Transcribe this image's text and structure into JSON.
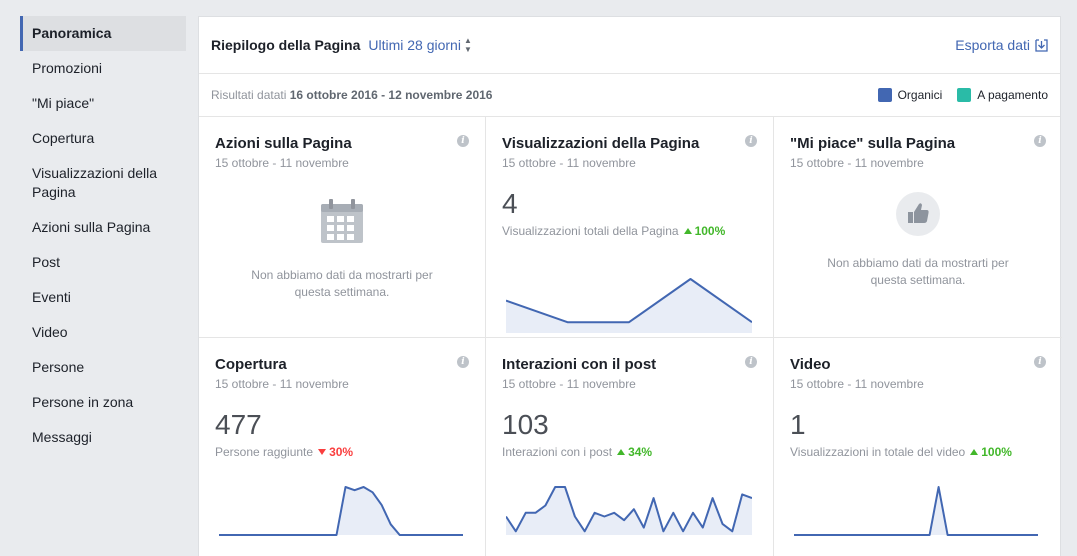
{
  "sidebar": {
    "items": [
      {
        "label": "Panoramica",
        "active": true
      },
      {
        "label": "Promozioni"
      },
      {
        "label": "\"Mi piace\""
      },
      {
        "label": "Copertura"
      },
      {
        "label": "Visualizzazioni della Pagina"
      },
      {
        "label": "Azioni sulla Pagina"
      },
      {
        "label": "Post"
      },
      {
        "label": "Eventi"
      },
      {
        "label": "Video"
      },
      {
        "label": "Persone"
      },
      {
        "label": "Persone in zona"
      },
      {
        "label": "Messaggi"
      }
    ]
  },
  "header": {
    "title": "Riepilogo della Pagina",
    "period": "Ultimi 28 giorni",
    "export_label": "Esporta dati"
  },
  "subheader": {
    "prefix": "Risultati datati",
    "range": "16 ottobre 2016 - 12 novembre 2016"
  },
  "legend": {
    "organic": {
      "label": "Organici",
      "color": "#4267b2"
    },
    "paid": {
      "label": "A pagamento",
      "color": "#2abba7"
    }
  },
  "cards": {
    "azioni": {
      "title": "Azioni sulla Pagina",
      "date": "15 ottobre - 11 novembre",
      "icon": "calendar-icon",
      "empty_text": "Non abbiamo dati da mostrarti per questa settimana."
    },
    "visualizzazioni": {
      "title": "Visualizzazioni della Pagina",
      "date": "15 ottobre - 11 novembre",
      "value": "4",
      "metric": "Visualizzazioni totali della Pagina",
      "delta": "100%",
      "trend": "up",
      "chart_data": {
        "type": "area",
        "values": [
          3,
          1,
          1,
          5,
          1
        ]
      }
    },
    "mipiace": {
      "title": "\"Mi piace\" sulla Pagina",
      "date": "15 ottobre - 11 novembre",
      "icon": "thumbs-up-icon",
      "empty_text": "Non abbiamo dati da mostrarti per questa settimana."
    },
    "copertura": {
      "title": "Copertura",
      "date": "15 ottobre - 11 novembre",
      "value": "477",
      "metric": "Persone raggiunte",
      "delta": "30%",
      "trend": "down",
      "chart_data": {
        "type": "area",
        "values": [
          0,
          0,
          0,
          0,
          0,
          0,
          0,
          0,
          0,
          0,
          0,
          0,
          0,
          0,
          45,
          42,
          45,
          40,
          28,
          10,
          0,
          0,
          0,
          0,
          0,
          0,
          0,
          0
        ]
      }
    },
    "interazioni": {
      "title": "Interazioni con il post",
      "date": "15 ottobre - 11 novembre",
      "value": "103",
      "metric": "Interazioni con i post",
      "delta": "34%",
      "trend": "up",
      "chart_data": {
        "type": "area",
        "values": [
          5,
          1,
          6,
          6,
          8,
          13,
          13,
          5,
          1,
          6,
          5,
          6,
          4,
          7,
          2,
          10,
          1,
          6,
          1,
          6,
          2,
          10,
          3,
          1,
          11,
          10
        ]
      }
    },
    "video": {
      "title": "Video",
      "date": "15 ottobre - 11 novembre",
      "value": "1",
      "metric": "Visualizzazioni in totale del video",
      "delta": "100%",
      "trend": "up",
      "chart_data": {
        "type": "area",
        "values": [
          0,
          0,
          0,
          0,
          0,
          0,
          0,
          0,
          0,
          0,
          0,
          0,
          0,
          0,
          0,
          0,
          12,
          0,
          0,
          0,
          0,
          0,
          0,
          0,
          0,
          0,
          0,
          0
        ]
      }
    }
  }
}
